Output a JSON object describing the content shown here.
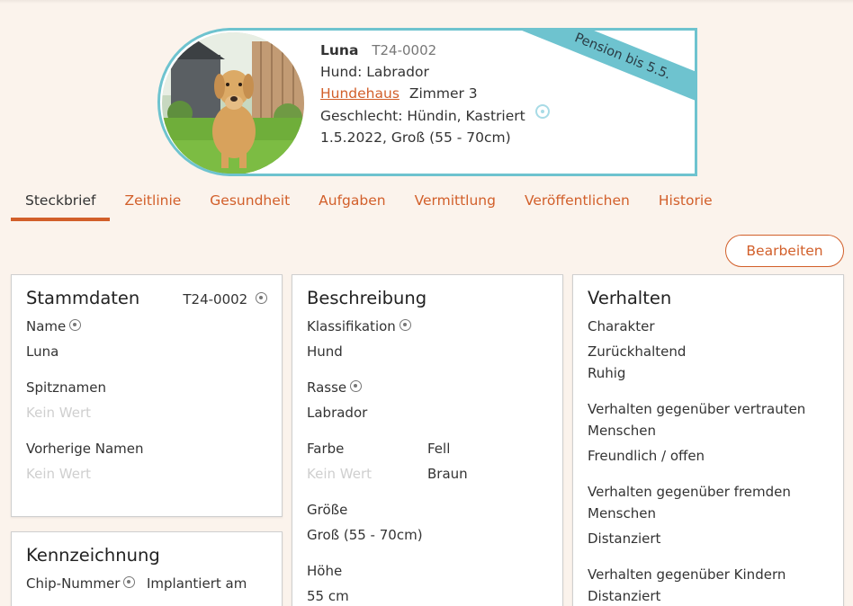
{
  "animal": {
    "name": "Luna",
    "code": "T24-0002",
    "species_line": "Hund: Labrador",
    "house_link": "Hundehaus",
    "room": "Zimmer 3",
    "gender_line": "Geschlecht: Hündin, Kastriert",
    "birth_size_line": "1.5.2022, Groß (55 - 70cm)",
    "ribbon": "Pension bis 5.5."
  },
  "tabs": [
    {
      "label": "Steckbrief"
    },
    {
      "label": "Zeitlinie"
    },
    {
      "label": "Gesundheit"
    },
    {
      "label": "Aufgaben"
    },
    {
      "label": "Vermittlung"
    },
    {
      "label": "Veröffentlichen"
    },
    {
      "label": "Historie"
    }
  ],
  "edit_label": "Bearbeiten",
  "stammdaten": {
    "title": "Stammdaten",
    "code": "T24-0002",
    "name_label": "Name",
    "name_value": "Luna",
    "nick_label": "Spitznamen",
    "nick_value": "Kein Wert",
    "prev_label": "Vorherige Namen",
    "prev_value": "Kein Wert"
  },
  "kennzeichnung": {
    "title": "Kennzeichnung",
    "chip_label": "Chip-Nummer",
    "implant_label": "Implantiert am"
  },
  "beschreibung": {
    "title": "Beschreibung",
    "class_label": "Klassifikation",
    "class_value": "Hund",
    "breed_label": "Rasse",
    "breed_value": "Labrador",
    "color_label": "Farbe",
    "color_value": "Kein Wert",
    "fur_label": "Fell",
    "fur_value": "Braun",
    "size_label": "Größe",
    "size_value": "Groß (55 - 70cm)",
    "height_label": "Höhe",
    "height_value": "55 cm"
  },
  "verhalten": {
    "title": "Verhalten",
    "char_label": "Charakter",
    "char_value_1": "Zurückhaltend",
    "char_value_2": "Ruhig",
    "familiar_label": "Verhalten gegenüber vertrauten Menschen",
    "familiar_value": "Freundlich / offen",
    "strangers_label": "Verhalten gegenüber fremden Menschen",
    "strangers_value": "Distanziert",
    "kids_label": "Verhalten gegenüber Kindern",
    "kids_value": "Distanziert"
  },
  "colors": {
    "accent": "#d25f2a",
    "teal": "#6ec3cf",
    "background": "#fbf3ec"
  }
}
